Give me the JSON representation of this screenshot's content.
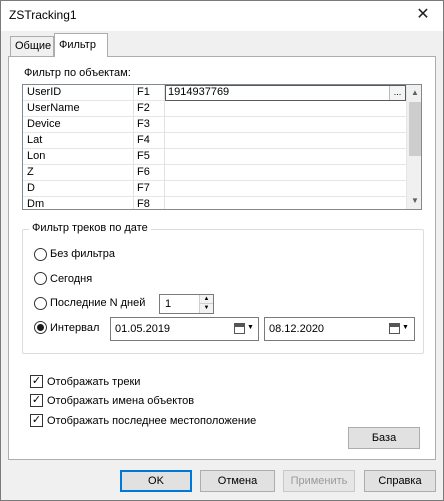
{
  "window": {
    "title": "ZSTracking1",
    "close_glyph": "✕"
  },
  "tabs": [
    {
      "label": "Общие",
      "active": false
    },
    {
      "label": "Фильтр",
      "active": true
    }
  ],
  "object_filter": {
    "label": "Фильтр по объектам:",
    "rows": [
      {
        "name": "UserID",
        "key": "F1",
        "value": "1914937769"
      },
      {
        "name": "UserName",
        "key": "F2",
        "value": ""
      },
      {
        "name": "Device",
        "key": "F3",
        "value": ""
      },
      {
        "name": "Lat",
        "key": "F4",
        "value": ""
      },
      {
        "name": "Lon",
        "key": "F5",
        "value": ""
      },
      {
        "name": "Z",
        "key": "F6",
        "value": ""
      },
      {
        "name": "D",
        "key": "F7",
        "value": ""
      },
      {
        "name": "Dm",
        "key": "F8",
        "value": ""
      }
    ],
    "ellipsis": "...",
    "scroll_up": "▲",
    "scroll_down": "▼"
  },
  "date_filter": {
    "title": "Фильтр треков по дате",
    "no_filter": "Без фильтра",
    "today": "Сегодня",
    "last_n_days": "Последние N дней",
    "last_n_value": "1",
    "interval": "Интервал",
    "selected": "interval",
    "date_from": "01.05.2019",
    "date_to": "08.12.2020"
  },
  "options": {
    "show_tracks": {
      "label": "Отображать треки",
      "checked": true
    },
    "show_names": {
      "label": "Отображать имена объектов",
      "checked": true
    },
    "show_last_location": {
      "label": "Отображать последнее местоположение",
      "checked": true
    },
    "check_glyph": "✓"
  },
  "base_button": "База",
  "footer": {
    "ok": "OK",
    "cancel": "Отмена",
    "apply": "Применить",
    "help": "Справка"
  }
}
